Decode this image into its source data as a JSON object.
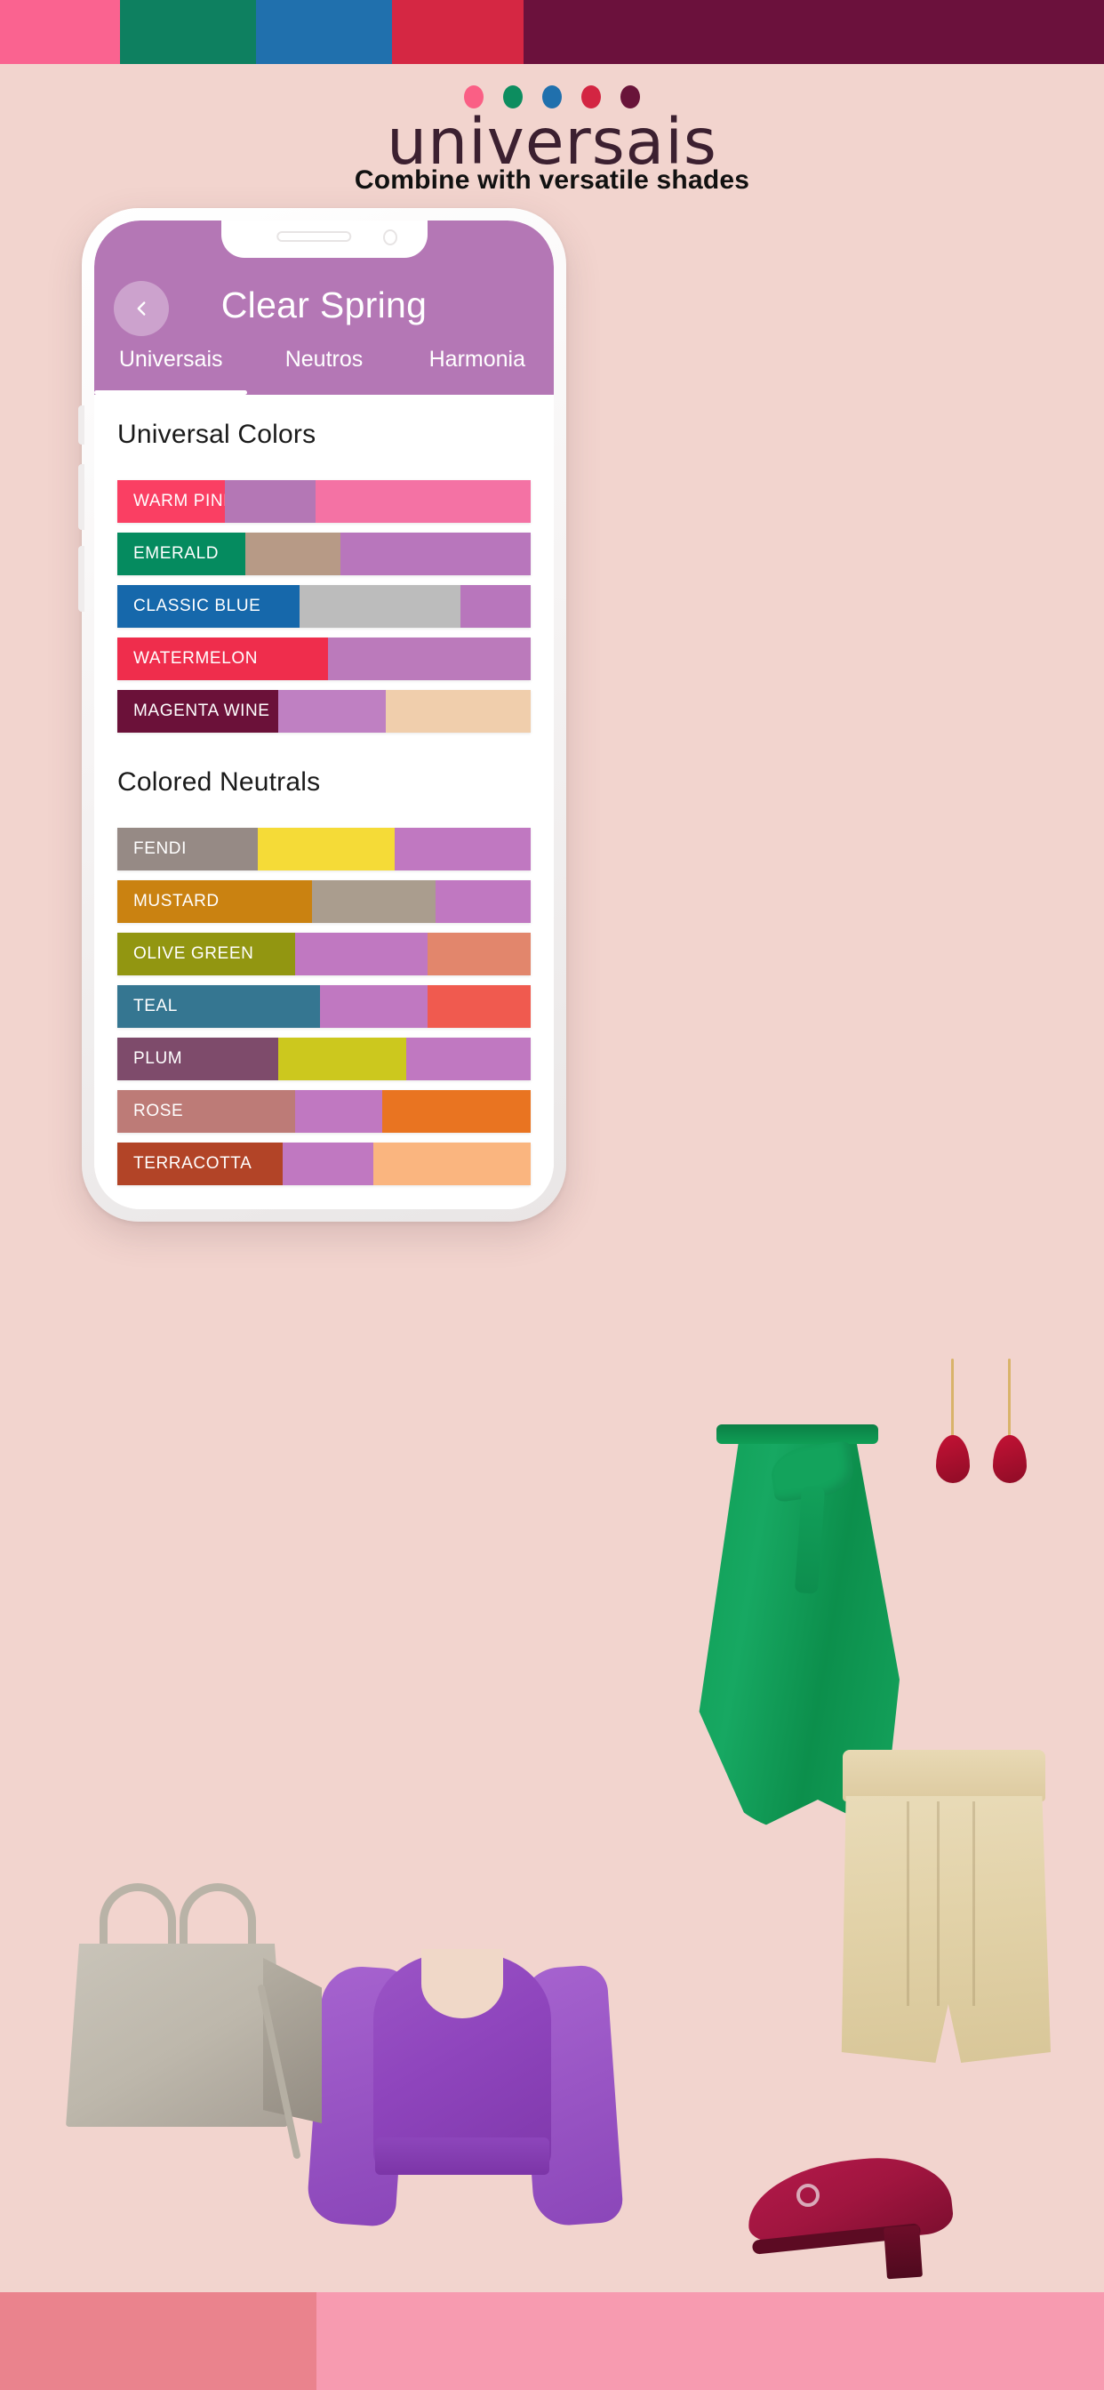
{
  "brand": {
    "title": "universais",
    "subtitle": "Combine with versatile shades",
    "dot_colors": [
      "#fa5f85",
      "#0d8d5f",
      "#2070ad",
      "#d32542",
      "#691339"
    ]
  },
  "top_strip": [
    {
      "name": "pink",
      "color": "#fa6390",
      "width_pct": 10.9
    },
    {
      "name": "emerald",
      "color": "#0e8060",
      "width_pct": 12.3
    },
    {
      "name": "classic-blue",
      "color": "#2070ad",
      "width_pct": 12.3
    },
    {
      "name": "watermelon",
      "color": "#d52743",
      "width_pct": 11.9
    },
    {
      "name": "magenta-wine",
      "color": "#6b113c",
      "width_pct": 52.6
    }
  ],
  "bottom_strip": [
    {
      "name": "rose-dark",
      "color": "#ea838d",
      "width_pct": 28.7
    },
    {
      "name": "rose-light",
      "color": "#f79bb0",
      "width_pct": 71.3
    }
  ],
  "app": {
    "header_color": "#b477b5",
    "title": "Clear Spring",
    "back_icon": "chevron-left-icon",
    "tabs": [
      {
        "label": "Universais",
        "active": true
      },
      {
        "label": "Neutros",
        "active": false
      },
      {
        "label": "Harmonia",
        "active": false
      }
    ],
    "sections": [
      {
        "title": "Universal Colors",
        "rows": [
          {
            "label": "WARM PINK",
            "swatches": [
              {
                "color": "#fa3f63",
                "pct": 26
              },
              {
                "color": "#b477b5",
                "pct": 22
              },
              {
                "color": "#f472a4",
                "pct": 52
              }
            ]
          },
          {
            "label": "EMERALD",
            "swatches": [
              {
                "color": "#058b5f",
                "pct": 31
              },
              {
                "color": "#b79a86",
                "pct": 23
              },
              {
                "color": "#b876bc",
                "pct": 46
              }
            ]
          },
          {
            "label": "CLASSIC BLUE",
            "swatches": [
              {
                "color": "#1668ab",
                "pct": 44
              },
              {
                "color": "#bcbcbc",
                "pct": 39
              },
              {
                "color": "#b876bc",
                "pct": 17
              }
            ]
          },
          {
            "label": "WATERMELON",
            "swatches": [
              {
                "color": "#ef2d4c",
                "pct": 51
              },
              {
                "color": "#bb7abb",
                "pct": 49
              }
            ]
          },
          {
            "label": "MAGENTA WINE",
            "swatches": [
              {
                "color": "#6b1139",
                "pct": 39
              },
              {
                "color": "#bf80c2",
                "pct": 26
              },
              {
                "color": "#f0ceac",
                "pct": 35
              }
            ]
          }
        ]
      },
      {
        "title": "Colored Neutrals",
        "rows": [
          {
            "label": "FENDI",
            "swatches": [
              {
                "color": "#968a85",
                "pct": 34
              },
              {
                "color": "#f5db37",
                "pct": 33
              },
              {
                "color": "#c078c1",
                "pct": 33
              }
            ]
          },
          {
            "label": "MUSTARD",
            "swatches": [
              {
                "color": "#ca8211",
                "pct": 47
              },
              {
                "color": "#aa9d8e",
                "pct": 30
              },
              {
                "color": "#c078c1",
                "pct": 23
              }
            ]
          },
          {
            "label": "OLIVE GREEN",
            "swatches": [
              {
                "color": "#929611",
                "pct": 43
              },
              {
                "color": "#c078c1",
                "pct": 32
              },
              {
                "color": "#e2866c",
                "pct": 25
              }
            ]
          },
          {
            "label": "TEAL",
            "swatches": [
              {
                "color": "#357691",
                "pct": 49
              },
              {
                "color": "#c078c1",
                "pct": 26
              },
              {
                "color": "#f05a4f",
                "pct": 25
              }
            ]
          },
          {
            "label": "PLUM",
            "swatches": [
              {
                "color": "#7e4b6b",
                "pct": 39
              },
              {
                "color": "#ccc81e",
                "pct": 31
              },
              {
                "color": "#c078c1",
                "pct": 30
              }
            ]
          },
          {
            "label": "ROSE",
            "swatches": [
              {
                "color": "#bd7b77",
                "pct": 43
              },
              {
                "color": "#c078c1",
                "pct": 21
              },
              {
                "color": "#e97421",
                "pct": 36
              }
            ]
          },
          {
            "label": "TERRACOTTA",
            "swatches": [
              {
                "color": "#b24427",
                "pct": 40
              },
              {
                "color": "#c078c1",
                "pct": 22
              },
              {
                "color": "#fab57f",
                "pct": 38
              }
            ]
          }
        ]
      }
    ]
  },
  "fashion_items": [
    {
      "name": "green-wrap-skirt",
      "color": "#13a35c"
    },
    {
      "name": "beige-shorts",
      "color": "#e4d4ac"
    },
    {
      "name": "purple-blouse",
      "color": "#9250c4"
    },
    {
      "name": "grey-handbag",
      "color": "#bdb7ab"
    },
    {
      "name": "burgundy-flat-shoe",
      "color": "#a0153f"
    },
    {
      "name": "red-drop-earrings",
      "color": "#b8112f"
    }
  ]
}
